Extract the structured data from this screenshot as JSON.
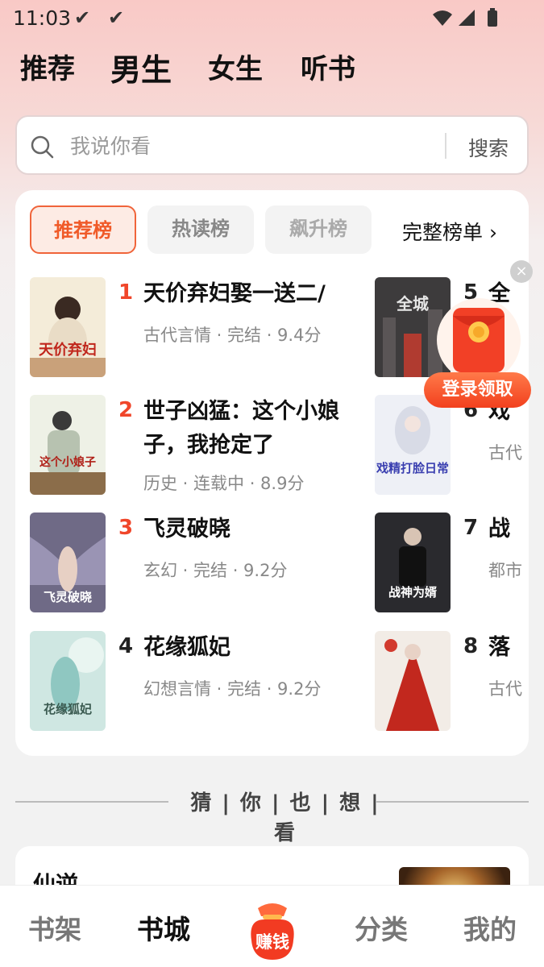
{
  "status_bar": {
    "time": "11:03"
  },
  "top_tabs": [
    "推荐",
    "男生",
    "女生",
    "听书"
  ],
  "search": {
    "placeholder": "我说你看",
    "button": "搜索"
  },
  "rank_tabs": [
    "推荐榜",
    "热读榜",
    "飙升榜"
  ],
  "full_list": "完整榜单 ›",
  "books": [
    {
      "rank": "1",
      "title": "天价弃妇娶一送二/",
      "meta": "古代言情 · 完结 · 9.4分",
      "cover_text": "天价弃妇"
    },
    {
      "rank": "2",
      "title": "世子凶猛：这个小娘子，我抢定了",
      "meta": "历史 · 连载中 · 8.9分",
      "cover_text": "这个小娘子"
    },
    {
      "rank": "3",
      "title": "飞灵破晓",
      "meta": "玄幻 · 完结 · 9.2分",
      "cover_text": "飞灵破晓"
    },
    {
      "rank": "4",
      "title": "花缘狐妃",
      "meta": "幻想言情 · 完结 · 9.2分",
      "cover_text": "花缘狐妃"
    },
    {
      "rank": "5",
      "title": "全",
      "meta": "",
      "cover_text": "全城"
    },
    {
      "rank": "6",
      "title": "戏",
      "meta": "古代",
      "cover_text": "戏精打脸日常"
    },
    {
      "rank": "7",
      "title": "战",
      "meta": "都市",
      "cover_text": "战神为婿"
    },
    {
      "rank": "8",
      "title": "落",
      "meta": "古代",
      "cover_text": ""
    }
  ],
  "promo": {
    "close": "×",
    "label": "登录领取"
  },
  "guess": {
    "title": "猜 | 你 | 也 | 想 | 看",
    "first_book": "仙逆"
  },
  "bottom_nav": {
    "shelf": "书架",
    "store": "书城",
    "earn": "赚钱",
    "category": "分类",
    "mine": "我的"
  },
  "colors": {
    "accent": "#f05a28",
    "rank_red": "#f0462a"
  }
}
